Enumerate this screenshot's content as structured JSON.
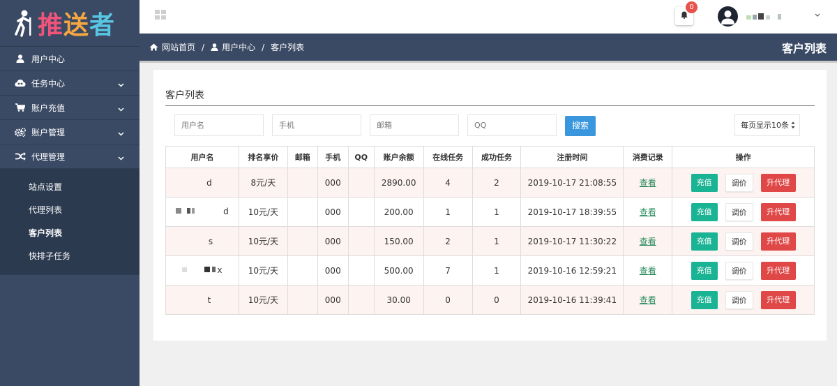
{
  "logo": {
    "chars": [
      "推",
      "送",
      "者"
    ]
  },
  "sidebar": {
    "items": [
      {
        "label": "用户中心",
        "icon": "user-icon",
        "has_chevron": false
      },
      {
        "label": "任务中心",
        "icon": "cloud-icon",
        "has_chevron": true
      },
      {
        "label": "账户充值",
        "icon": "cart-icon",
        "has_chevron": true
      },
      {
        "label": "账户管理",
        "icon": "gears-icon",
        "has_chevron": true
      },
      {
        "label": "代理管理",
        "icon": "shuffle-icon",
        "has_chevron": true
      }
    ],
    "subitems": [
      {
        "label": "站点设置"
      },
      {
        "label": "代理列表"
      },
      {
        "label": "客户列表",
        "active": true
      },
      {
        "label": "快排子任务"
      }
    ]
  },
  "header": {
    "notification_count": "0",
    "user_name_partial": "`"
  },
  "breadcrumb": {
    "items": [
      "网站首页",
      "用户中心",
      "客户列表"
    ],
    "separator": "/",
    "page_title": "客户列表"
  },
  "main": {
    "title": "客户列表",
    "filters": {
      "username_placeholder": "用户名",
      "phone_placeholder": "手机",
      "email_placeholder": "邮箱",
      "qq_placeholder": "QQ",
      "search_label": "搜索",
      "page_size": "每页显示10条"
    },
    "table": {
      "columns": [
        "用户名",
        "排名享价",
        "邮箱",
        "手机",
        "QQ",
        "账户余额",
        "在线任务",
        "成功任务",
        "注册时间",
        "消费记录",
        "操作"
      ],
      "rows": [
        {
          "username": "d",
          "price": "8元/天",
          "email": "",
          "phone": "000",
          "qq": "",
          "balance": "2890.00",
          "online": "4",
          "success": "2",
          "registered": "2019-10-17 21:08:55",
          "record": "查看"
        },
        {
          "username": "d",
          "price": "10元/天",
          "email": "",
          "phone": "000",
          "qq": "",
          "balance": "200.00",
          "online": "1",
          "success": "1",
          "registered": "2019-10-17 18:39:55",
          "record": "查看"
        },
        {
          "username": "s",
          "price": "10元/天",
          "email": "",
          "phone": "000",
          "qq": "",
          "balance": "150.00",
          "online": "2",
          "success": "1",
          "registered": "2019-10-17 11:30:22",
          "record": "查看"
        },
        {
          "username": "x",
          "price": "10元/天",
          "email": "",
          "phone": "000",
          "qq": "",
          "balance": "500.00",
          "online": "7",
          "success": "1",
          "registered": "2019-10-16 12:59:21",
          "record": "查看"
        },
        {
          "username": "t",
          "price": "10元/天",
          "email": "",
          "phone": "000",
          "qq": "",
          "balance": "30.00",
          "online": "0",
          "success": "0",
          "registered": "2019-10-16 11:39:41",
          "record": "查看"
        }
      ],
      "actions": {
        "recharge": "充值",
        "adjust": "调价",
        "upgrade": "升代理"
      }
    }
  },
  "colors": {
    "sidebar_bg": "#3a4a64",
    "accent_blue": "#3a97dd",
    "btn_green": "#1ab394",
    "btn_red": "#e04848",
    "row_tint": "#fdf3f1",
    "badge_red": "#e8524a"
  }
}
